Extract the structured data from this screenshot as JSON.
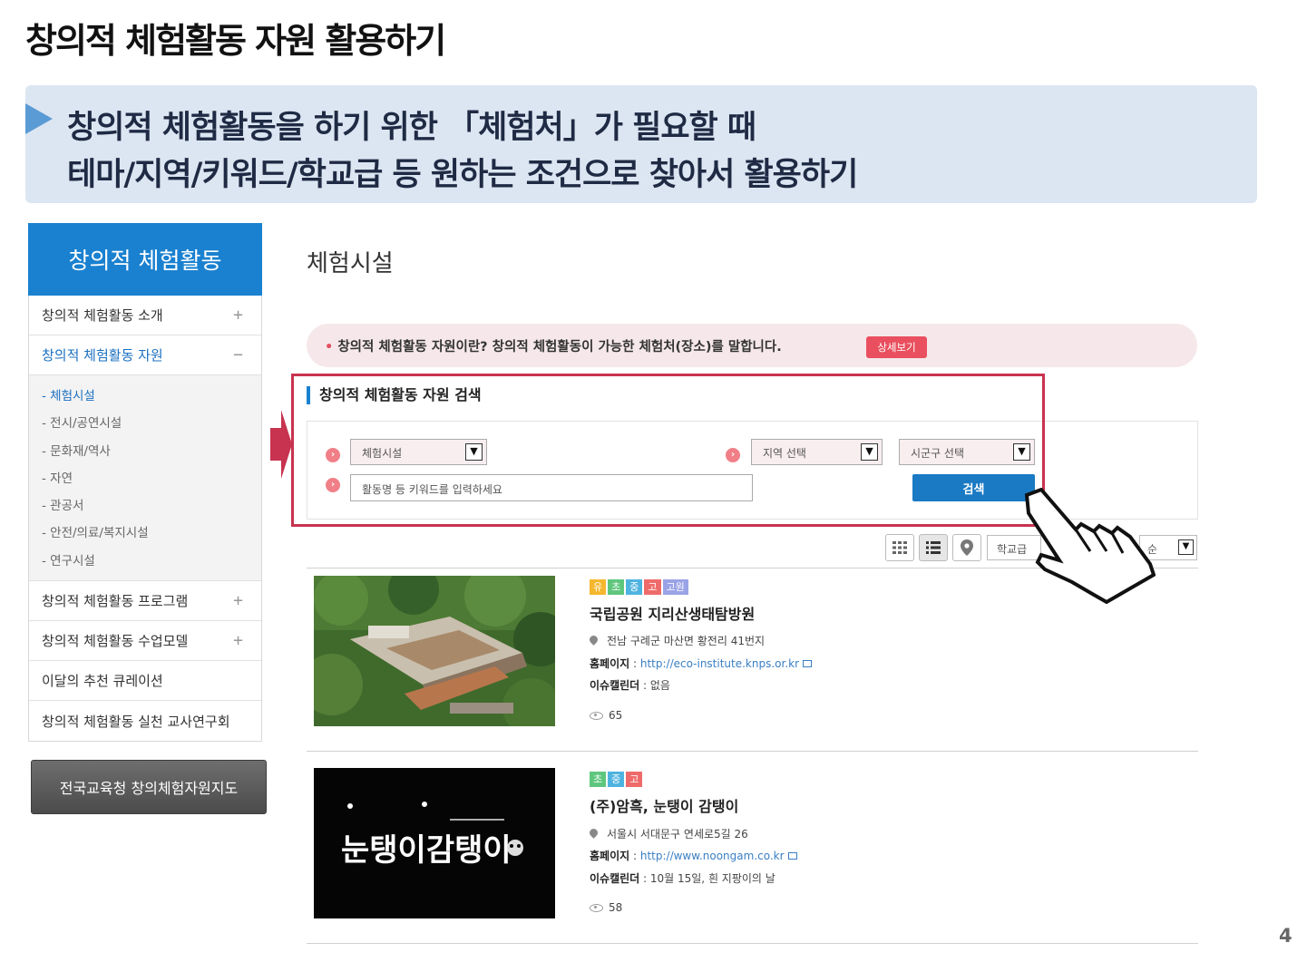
{
  "slide": {
    "title": "창의적 체험활동 자원 활용하기",
    "banner_line1": "창의적 체험활동을 하기 위한 「체험처」가 필요할 때",
    "banner_line2": "테마/지역/키워드/학교급 등 원하는 조건으로 찾아서 활용하기",
    "page_number": "4"
  },
  "sidebar": {
    "header": "창의적 체험활동",
    "items": [
      {
        "label": "창의적 체험활동 소개",
        "sign": "+"
      },
      {
        "label": "창의적 체험활동 자원",
        "sign": "−"
      }
    ],
    "sub_items": [
      "- 체험시설",
      "- 전시/공연시설",
      "- 문화재/역사",
      "- 자연",
      "- 관공서",
      "- 안전/의료/복지시설",
      "- 연구시설"
    ],
    "items_after": [
      {
        "label": "창의적 체험활동 프로그램",
        "sign": "+"
      },
      {
        "label": "창의적 체험활동 수업모델",
        "sign": "+"
      },
      {
        "label": "이달의 추천 큐레이션",
        "sign": ""
      },
      {
        "label": "창의적 체험활동 실천 교사연구회",
        "sign": ""
      }
    ],
    "map_button": "전국교육청 창의체험자원지도"
  },
  "main": {
    "heading": "체험시설",
    "notice": "창의적 체험활동 자원이란? 창의적 체험활동이 가능한 체험처(장소)를 말합니다.",
    "notice_bullet": "•",
    "notice_button": "상세보기",
    "search": {
      "title": "창의적 체험활동 자원 검색",
      "category": "체험시설",
      "region": "지역 선택",
      "district": "시군구 선택",
      "keyword_placeholder": "활동명 등 키워드를 입력하세요",
      "button": "검색"
    },
    "sort": {
      "school_level": "학교급",
      "order": "순"
    }
  },
  "listings": [
    {
      "badges": [
        "유",
        "초",
        "중",
        "고",
        "고원"
      ],
      "title": "국립공원 지리산생태탐방원",
      "address": "전남 구례군 마산면 황전리 41번지",
      "homepage_label": "홈페이지",
      "homepage": "http://eco-institute.knps.or.kr",
      "calendar_label": "이슈캘린더",
      "calendar": "없음",
      "views": "65"
    },
    {
      "badges": [
        "초",
        "중",
        "고"
      ],
      "title": "(주)암흑, 눈탱이 감탱이",
      "address": "서울시 서대문구 연세로5길 26",
      "homepage_label": "홈페이지",
      "homepage": "http://www.noongam.co.kr",
      "calendar_label": "이슈캘린더",
      "calendar": "10월 15일, 흰 지팡이의 날",
      "views": "58",
      "logo_text": "눈탱이감탱이"
    }
  ],
  "colors": {
    "sidebar_header": "#1a81d0",
    "highlight_border": "#c8334f",
    "search_button": "#1a7ac4",
    "banner_bg": "#dce6f2"
  }
}
